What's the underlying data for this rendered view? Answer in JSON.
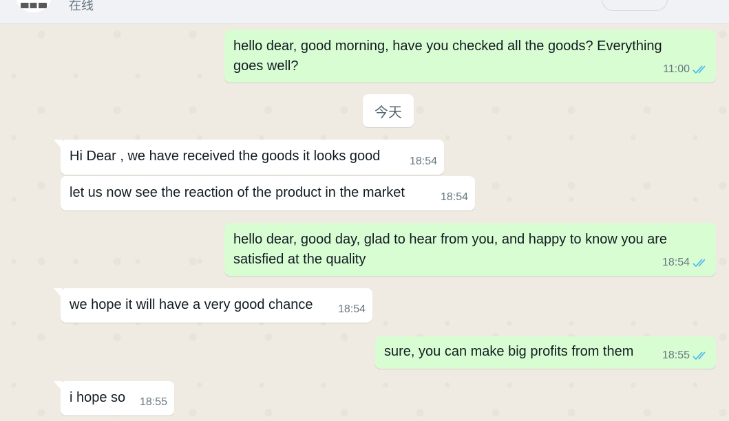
{
  "header": {
    "status": "在线"
  },
  "date_separator": "今天",
  "messages": [
    {
      "direction": "out",
      "text_lines": [
        "hello dear, good morning, have you checked all the goods? Everything",
        "goes well?"
      ],
      "time": "11:00",
      "status": "read"
    },
    {
      "direction": "in",
      "text_lines": [
        "Hi Dear , we have received the goods it looks good"
      ],
      "time": "18:54"
    },
    {
      "direction": "in",
      "text_lines": [
        "let us now see the reaction of the product in the market"
      ],
      "time": "18:54"
    },
    {
      "direction": "out",
      "text_lines": [
        "hello dear, good day, glad to hear from you, and happy to know you are",
        "satisfied at the quality"
      ],
      "time": "18:54",
      "status": "read"
    },
    {
      "direction": "in",
      "text_lines": [
        "we hope it will have a very good chance"
      ],
      "time": "18:54"
    },
    {
      "direction": "out",
      "text_lines": [
        "sure, you can make big profits from them"
      ],
      "time": "18:55",
      "status": "read"
    },
    {
      "direction": "in",
      "text_lines": [
        "i hope so"
      ],
      "time": "18:55"
    }
  ],
  "colors": {
    "outgoing_bubble": "#d9fdd3",
    "incoming_bubble": "#ffffff",
    "chat_background": "#efeae2",
    "read_ticks": "#53bdeb"
  },
  "icons": {
    "read_receipt": "double-check-icon",
    "header_menu": "chevron-down-icon"
  }
}
